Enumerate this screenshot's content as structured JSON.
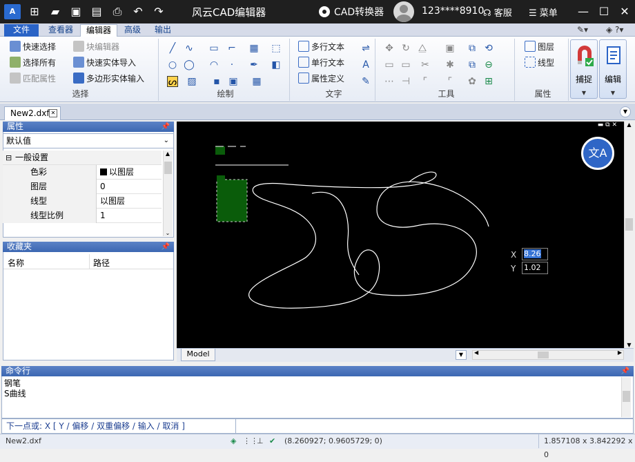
{
  "app": {
    "title": "风云CAD编辑器",
    "logo_text": "A",
    "converter_label": "CAD转换器",
    "phone": "123****8910",
    "service_label": "客服",
    "menu_label": "菜单"
  },
  "quick_toolbar": [
    "new-icon",
    "open-folder-icon",
    "save-icon",
    "save-pdf-icon",
    "print-icon",
    "undo-icon",
    "redo-icon"
  ],
  "menu_tabs": [
    "文件",
    "查看器",
    "编辑器",
    "高级",
    "输出"
  ],
  "active_tab": "编辑器",
  "ribbon": {
    "select_group": {
      "title": "选择",
      "items": [
        "快速选择",
        "选择所有",
        "匹配属性",
        "块编辑器",
        "快速实体导入",
        "多边形实体输入"
      ]
    },
    "draw_group": {
      "title": "绘制"
    },
    "text_group": {
      "title": "文字",
      "items": [
        "多行文本",
        "单行文本",
        "属性定义"
      ]
    },
    "tools_group": {
      "title": "工具"
    },
    "props_group": {
      "title": "属性",
      "items": [
        "图层",
        "线型"
      ]
    },
    "snap_label": "捕捉",
    "edit_label": "编辑"
  },
  "doc_tab": "New2.dxf",
  "properties_panel": {
    "header": "属性",
    "selector_value": "默认值",
    "section": "一般设置",
    "rows": [
      {
        "key": "色彩",
        "value": "以图层"
      },
      {
        "key": "图层",
        "value": "0"
      },
      {
        "key": "线型",
        "value": "以图层"
      },
      {
        "key": "线型比例",
        "value": "1"
      }
    ]
  },
  "favorites_panel": {
    "header": "收藏夹",
    "col_name": "名称",
    "col_path": "路径"
  },
  "canvas": {
    "model_tab": "Model",
    "x_label": "X",
    "x_value": "8.26",
    "y_label": "Y",
    "y_value": "1.02"
  },
  "command_panel": {
    "header": "命令行",
    "lines": [
      "钢笔",
      "S曲线"
    ]
  },
  "prompt": {
    "text": "下一点或: X [ Y / 偏移 / 双重偏移 / 输入 / 取消 ]"
  },
  "status": {
    "file": "New2.dxf",
    "cursor": "(8.260927; 0.9605729; 0)",
    "size": "1.857108 x 3.842292 x 0"
  }
}
